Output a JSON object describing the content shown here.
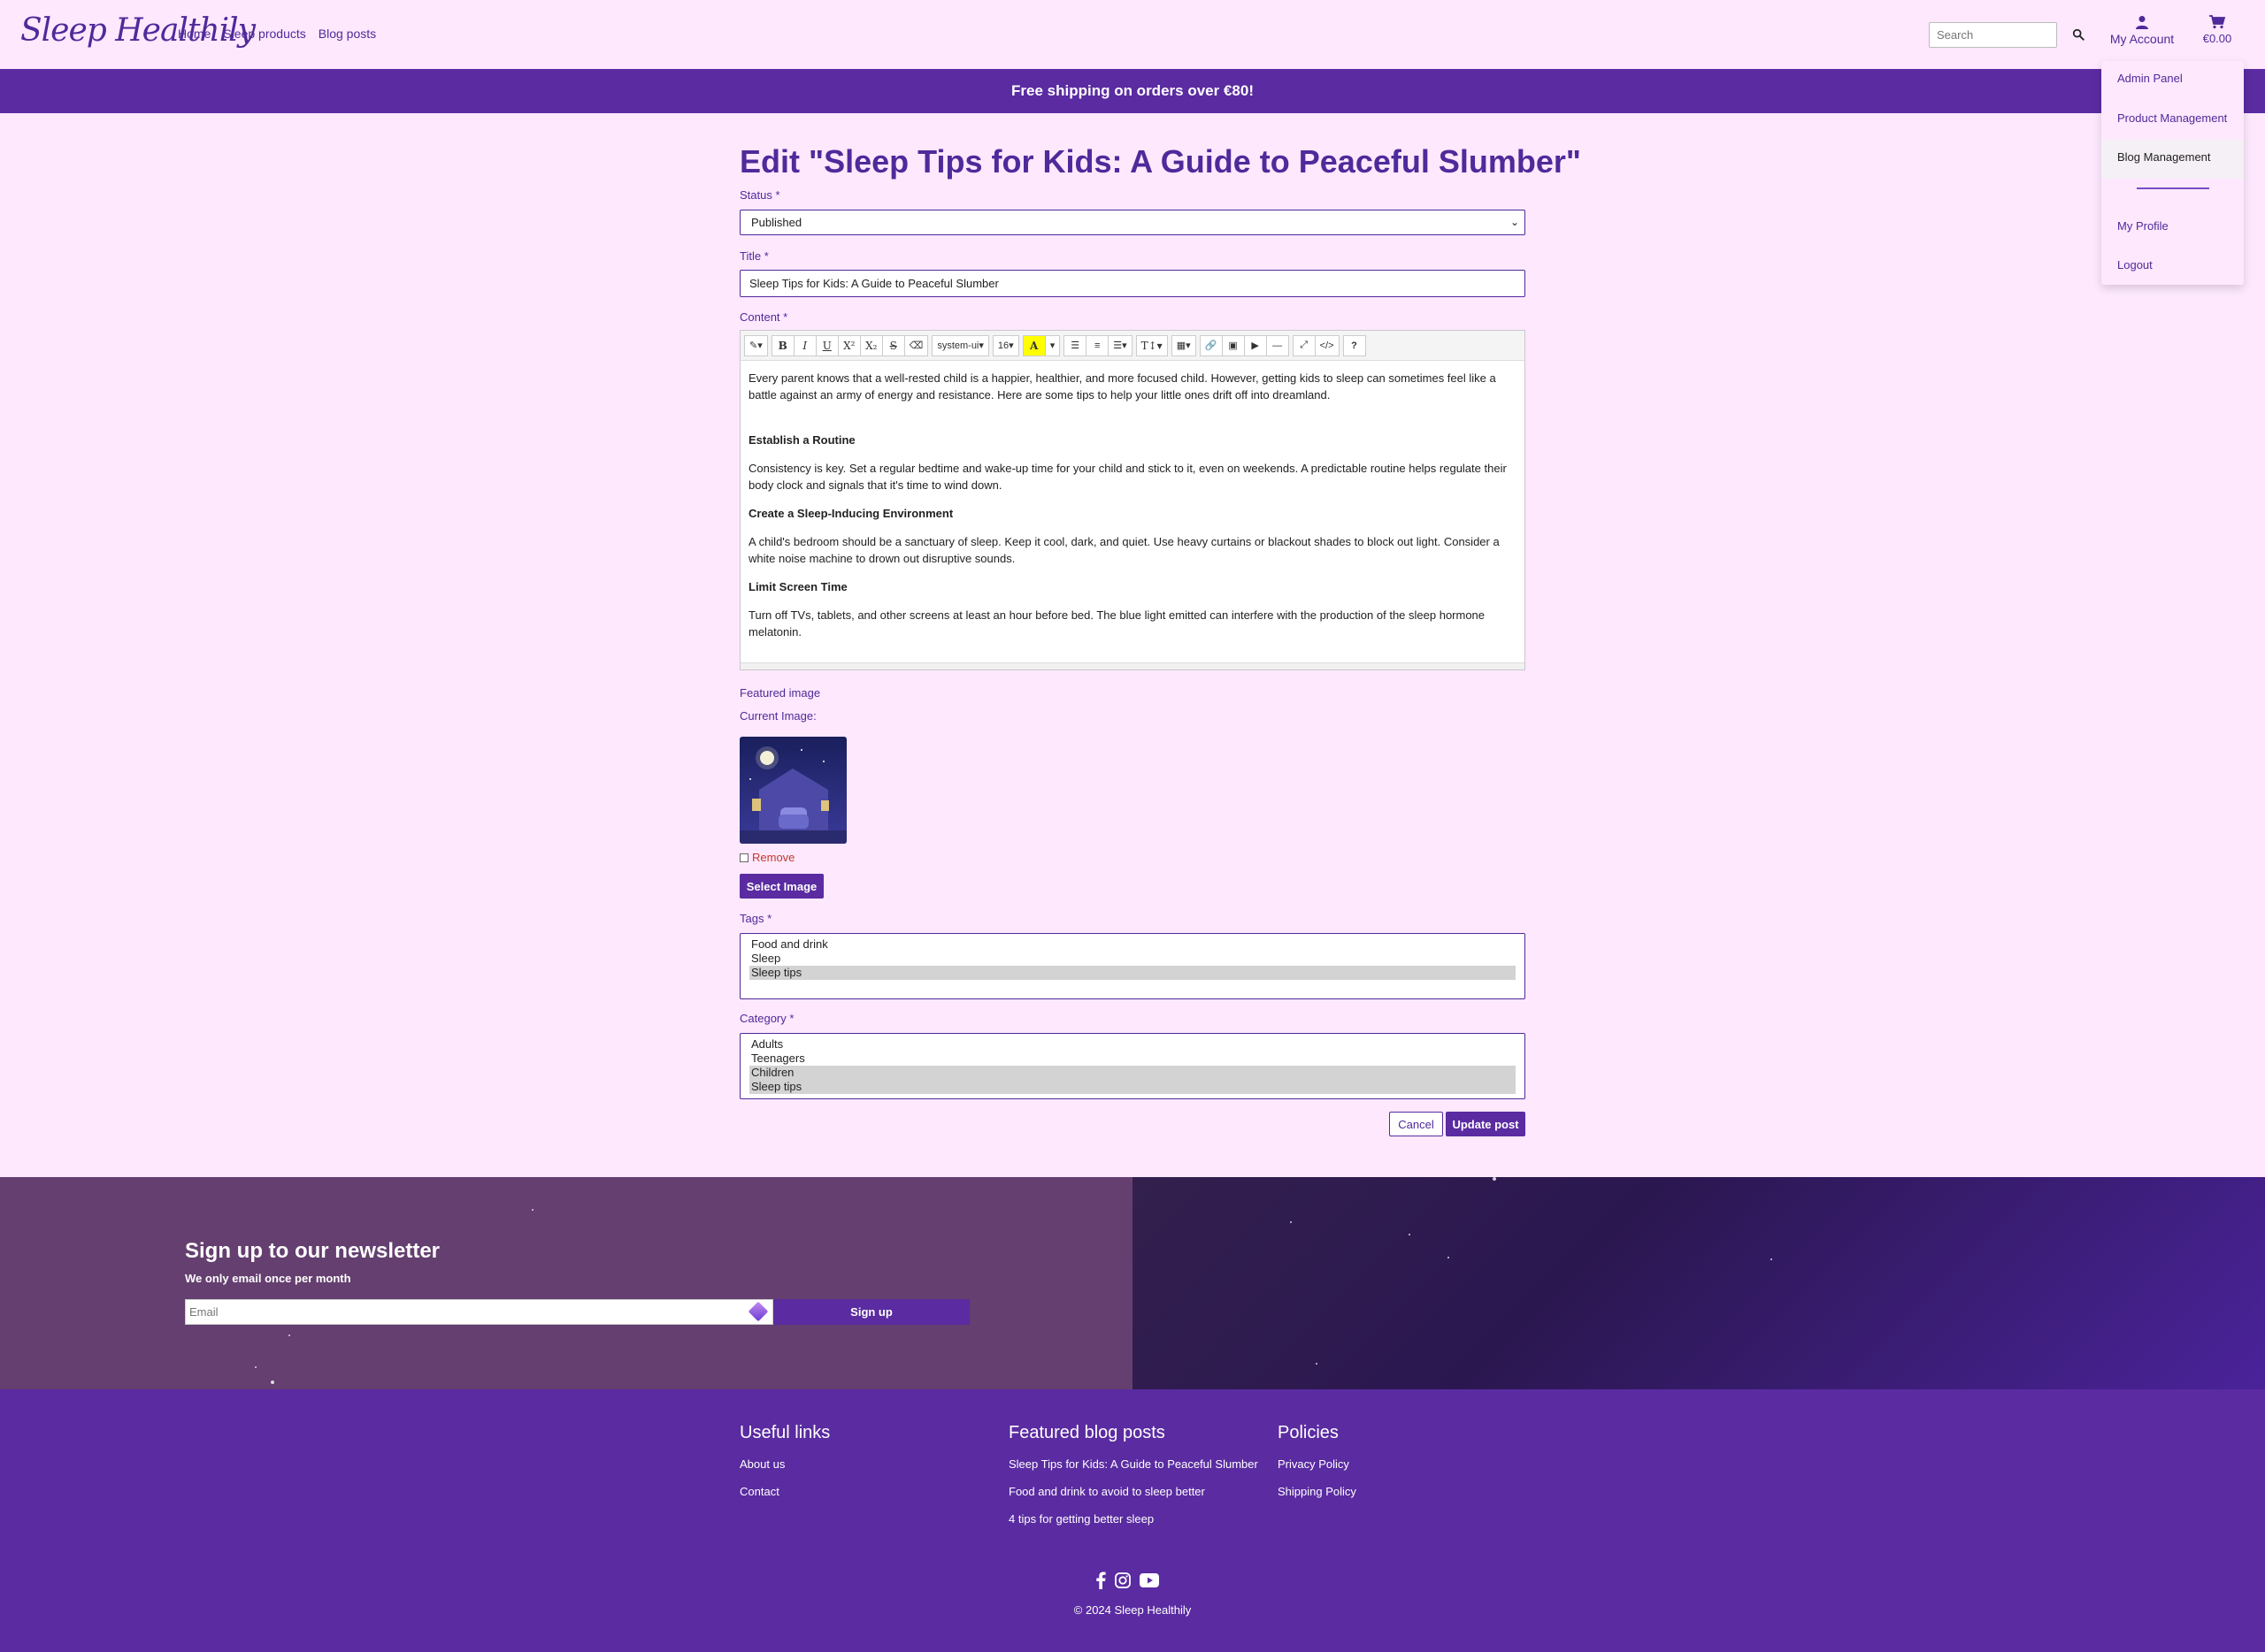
{
  "header": {
    "logo": "Sleep Healthily",
    "nav": [
      "Home",
      "Sleep products",
      "Blog posts"
    ],
    "search_placeholder": "Search",
    "account_label": "My Account",
    "cart_total": "€0.00"
  },
  "account_menu": {
    "items": [
      "Admin Panel",
      "Product Management",
      "Blog Management",
      "My Profile",
      "Logout"
    ]
  },
  "banner": "Free shipping on orders over €80!",
  "form": {
    "page_title": "Edit \"Sleep Tips for Kids: A Guide to Peaceful Slumber\"",
    "status_label": "Status *",
    "status_value": "Published",
    "title_label": "Title *",
    "title_value": "Sleep Tips for Kids: A Guide to Peaceful Slumber",
    "content_label": "Content *",
    "toolbar": {
      "font_name": "system-ui",
      "font_size": "16"
    },
    "content": {
      "intro": "Every parent knows that a well-rested child is a happier, healthier, and more focused child. However, getting kids to sleep can sometimes feel like a battle against an army of energy and resistance. Here are some tips to help your little ones drift off into dreamland.",
      "h1": "Establish a Routine",
      "p1": "Consistency is key. Set a regular bedtime and wake-up time for your child and stick to it, even on weekends. A predictable routine helps regulate their body clock and signals that it's time to wind down.",
      "h2": "Create a Sleep-Inducing Environment",
      "p2": "A child's bedroom should be a sanctuary of sleep. Keep it cool, dark, and quiet. Use heavy curtains or blackout shades to block out light. Consider a white noise machine to drown out disruptive sounds.",
      "h3": "Limit Screen Time",
      "p3": "Turn off TVs, tablets, and other screens at least an hour before bed. The blue light emitted can interfere with the production of the sleep hormone melatonin."
    },
    "featured_label": "Featured image",
    "current_image_label": "Current Image:",
    "remove_label": "Remove",
    "select_image_btn": "Select Image",
    "tags_label": "Tags *",
    "tags": [
      {
        "label": "Food and drink",
        "selected": false
      },
      {
        "label": "Sleep",
        "selected": false
      },
      {
        "label": "Sleep tips",
        "selected": true
      }
    ],
    "category_label": "Category *",
    "categories": [
      {
        "label": "Adults",
        "selected": false
      },
      {
        "label": "Teenagers",
        "selected": false
      },
      {
        "label": "Children",
        "selected": true
      },
      {
        "label": "Sleep tips",
        "selected": true
      }
    ],
    "cancel_btn": "Cancel",
    "update_btn": "Update post"
  },
  "newsletter": {
    "title": "Sign up to our newsletter",
    "subtitle": "We only email once per month",
    "email_placeholder": "Email",
    "button": "Sign up"
  },
  "footer": {
    "useful_links_title": "Useful links",
    "useful_links": [
      "About us",
      "Contact"
    ],
    "featured_title": "Featured blog posts",
    "featured_links": [
      "Sleep Tips for Kids: A Guide to Peaceful Slumber",
      "Food and drink to avoid to sleep better",
      "4 tips for getting better sleep"
    ],
    "policies_title": "Policies",
    "policies_links": [
      "Privacy Policy",
      "Shipping Policy"
    ],
    "copyright": "© 2024 Sleep Healthily"
  },
  "colors": {
    "brand_purple": "#5a2ba1",
    "page_bg": "#fde8fd",
    "link_purple": "#4e2a9a",
    "remove_red": "#c0392b"
  },
  "icons": [
    "search-icon",
    "user-icon",
    "cart-icon",
    "facebook-icon",
    "instagram-icon",
    "youtube-icon"
  ]
}
